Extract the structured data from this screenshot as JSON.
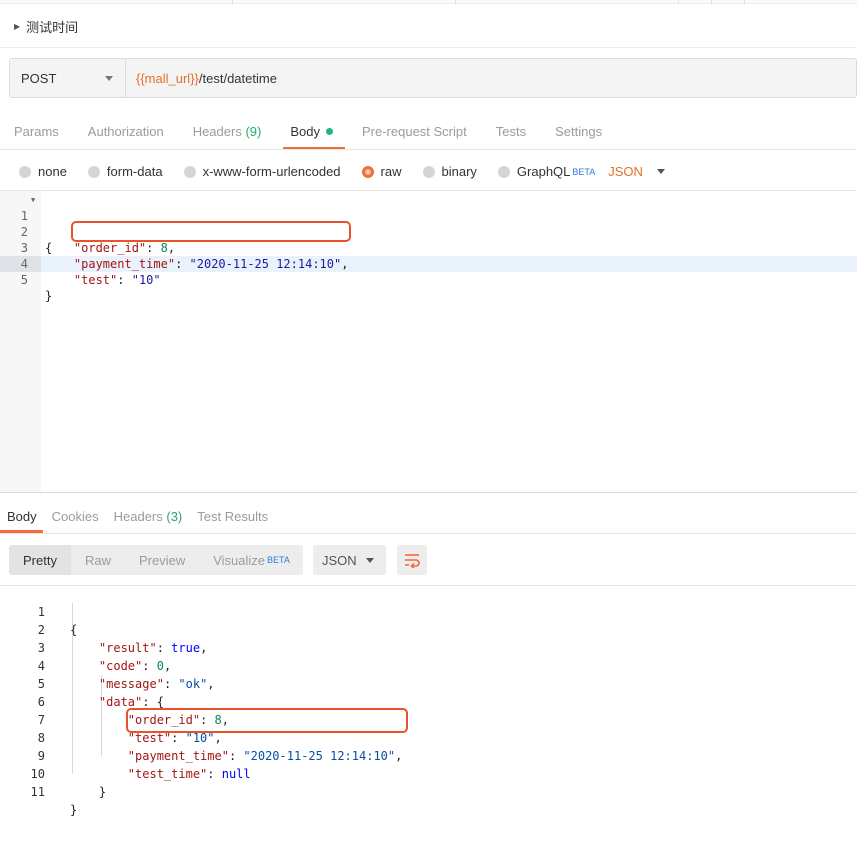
{
  "request": {
    "name": "测试时间",
    "method": "POST",
    "url_var": "{{mall_url}}",
    "url_path": "/test/datetime"
  },
  "request_tabs": [
    {
      "label": "Params"
    },
    {
      "label": "Authorization"
    },
    {
      "label": "Headers",
      "count": "(9)"
    },
    {
      "label": "Body",
      "active": true
    },
    {
      "label": "Pre-request Script"
    },
    {
      "label": "Tests"
    },
    {
      "label": "Settings"
    }
  ],
  "body_types": [
    {
      "label": "none"
    },
    {
      "label": "form-data"
    },
    {
      "label": "x-www-form-urlencoded"
    },
    {
      "label": "raw",
      "selected": true
    },
    {
      "label": "binary"
    },
    {
      "label": "GraphQL",
      "beta": "BETA"
    }
  ],
  "raw_format": "JSON",
  "request_body": {
    "line_numbers": [
      "1",
      "2",
      "3",
      "4",
      "5"
    ],
    "open_brace": "{",
    "close_brace": "}",
    "key_order_id": "\"order_id\"",
    "val_order_id": "8",
    "key_payment_time": "\"payment_time\"",
    "val_payment_time": "\"2020-11-25 12:14:10\"",
    "key_test": "\"test\"",
    "val_test": "\"10\""
  },
  "response_tabs": [
    {
      "label": "Body",
      "active": true
    },
    {
      "label": "Cookies"
    },
    {
      "label": "Headers",
      "count": "(3)"
    },
    {
      "label": "Test Results"
    }
  ],
  "view_modes": {
    "pretty": "Pretty",
    "raw": "Raw",
    "preview": "Preview",
    "visualize": "Visualize",
    "visualize_beta": "BETA"
  },
  "response_format": "JSON",
  "response_body": {
    "line_numbers": [
      "1",
      "2",
      "3",
      "4",
      "5",
      "6",
      "7",
      "8",
      "9",
      "10",
      "11"
    ],
    "open_brace": "{",
    "close_brace": "}",
    "key_result": "\"result\"",
    "val_result": "true",
    "key_code": "\"code\"",
    "val_code": "0",
    "key_message": "\"message\"",
    "val_message": "\"ok\"",
    "key_data": "\"data\"",
    "key_order_id": "\"order_id\"",
    "val_order_id": "8",
    "key_test": "\"test\"",
    "val_test": "\"10\"",
    "key_payment_time": "\"payment_time\"",
    "val_payment_time": "\"2020-11-25 12:14:10\"",
    "key_test_time": "\"test_time\"",
    "val_test_time": "null"
  },
  "colors": {
    "accent": "#f26b3a",
    "highlight_box": "#e8532b",
    "variable": "#e5702a",
    "count_green": "#26a86a",
    "beta_blue": "#2f7bd9"
  }
}
